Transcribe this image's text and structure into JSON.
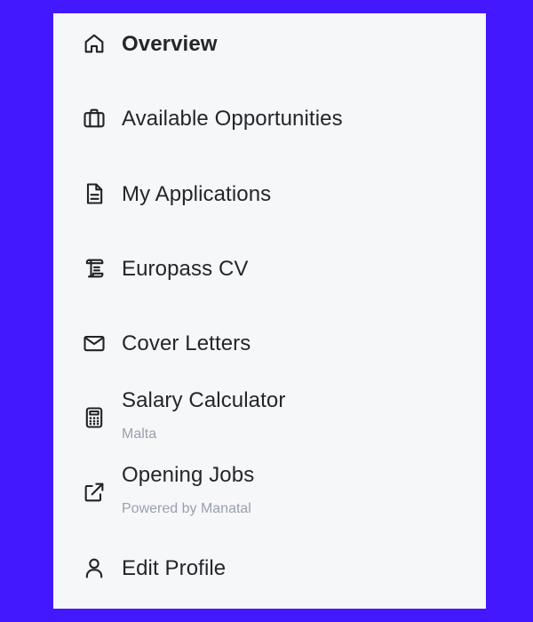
{
  "nav": {
    "items": [
      {
        "label": "Overview",
        "icon": "home-icon",
        "active": true
      },
      {
        "label": "Available Opportunities",
        "icon": "briefcase-icon"
      },
      {
        "label": "My Applications",
        "icon": "document-icon"
      },
      {
        "label": "Europass CV",
        "icon": "scroll-icon"
      },
      {
        "label": "Cover Letters",
        "icon": "envelope-icon"
      },
      {
        "label": "Salary Calculator",
        "sublabel": "Malta",
        "icon": "calculator-icon"
      },
      {
        "label": "Opening Jobs",
        "sublabel": "Powered by Manatal",
        "icon": "external-link-icon"
      },
      {
        "label": "Edit Profile",
        "icon": "user-icon"
      }
    ]
  },
  "colors": {
    "background": "#4318ff",
    "panel": "#f6f7f9",
    "text": "#23262b",
    "subtext": "#9aa1ab"
  }
}
